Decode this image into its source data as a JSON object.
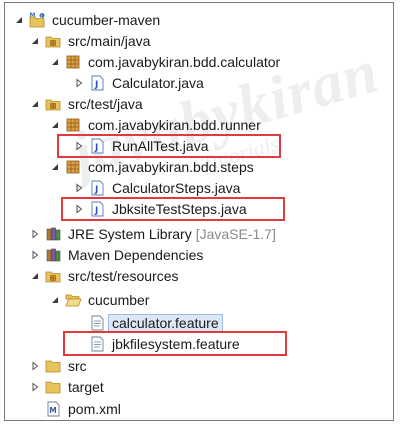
{
  "tree": {
    "project": "cucumber-maven",
    "src_main_java": "src/main/java",
    "pkg_calculator": "com.javabykiran.bdd.calculator",
    "calculator_java": "Calculator.java",
    "src_test_java": "src/test/java",
    "pkg_runner": "com.javabykiran.bdd.runner",
    "run_all_test": "RunAllTest.java",
    "pkg_steps": "com.javabykiran.bdd.steps",
    "calculator_steps": "CalculatorSteps.java",
    "jbksite_steps": "JbksiteTestSteps.java",
    "jre_library": "JRE System Library",
    "jre_version": "[JavaSE-1.7]",
    "maven_deps": "Maven Dependencies",
    "src_test_resources": "src/test/resources",
    "cucumber_folder": "cucumber",
    "calculator_feature": "calculator.feature",
    "jbk_feature": "jbkfilesystem.feature",
    "src_folder": "src",
    "target_folder": "target",
    "pom": "pom.xml"
  },
  "watermark": {
    "main": "javabykiran",
    "sub": "Tutorials"
  },
  "colors": {
    "highlight": "#e0393e",
    "selection": "#dce8f7",
    "package": "#c98a2b",
    "folder": "#e8c35b",
    "java_file": "#5478b8"
  },
  "icons": {
    "project": "maven-project-icon",
    "source_folder": "source-folder-icon",
    "package": "package-icon",
    "java_file": "java-file-icon",
    "library": "library-icon",
    "folder": "folder-icon",
    "feature_file": "feature-file-icon",
    "xml_file": "xml-file-icon"
  }
}
